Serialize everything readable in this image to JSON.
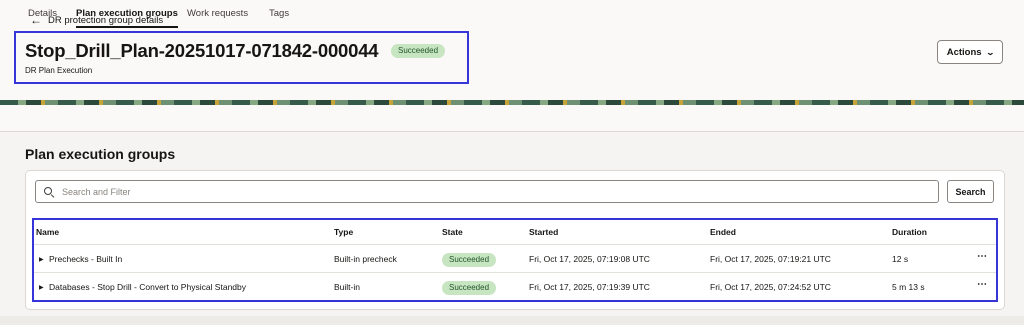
{
  "header": {
    "back_label": "DR protection group details",
    "title": "Stop_Drill_Plan-20251017-071842-000044",
    "status": "Succeeded",
    "subtitle": "DR Plan Execution",
    "actions_label": "Actions",
    "actions_icon": "chevron-down-icon",
    "back_icon": "arrow-left-icon"
  },
  "tabs": [
    {
      "label": "Details",
      "active": false
    },
    {
      "label": "Plan execution groups",
      "active": true
    },
    {
      "label": "Work requests",
      "active": false
    },
    {
      "label": "Tags",
      "active": false
    }
  ],
  "section": {
    "title": "Plan execution groups"
  },
  "search": {
    "placeholder": "Search and Filter",
    "value": "",
    "button_label": "Search",
    "icon": "search-icon"
  },
  "table": {
    "columns": [
      "Name",
      "Type",
      "State",
      "Started",
      "Ended",
      "Duration"
    ],
    "rows": [
      {
        "name": "Prechecks - Built In",
        "type": "Built-in precheck",
        "state": "Succeeded",
        "started": "Fri, Oct 17, 2025, 07:19:08 UTC",
        "ended": "Fri, Oct 17, 2025, 07:19:21 UTC",
        "duration": "12 s",
        "menu": "⋯"
      },
      {
        "name": "Databases - Stop Drill - Convert to Physical Standby",
        "type": "Built-in",
        "state": "Succeeded",
        "started": "Fri, Oct 17, 2025, 07:19:39 UTC",
        "ended": "Fri, Oct 17, 2025, 07:24:52 UTC",
        "duration": "5 m 13 s",
        "menu": "⋯"
      }
    ]
  },
  "colors": {
    "accent_highlight": "#3535d8",
    "success_badge_bg": "#c6e5c0",
    "success_badge_text": "#22552b"
  }
}
